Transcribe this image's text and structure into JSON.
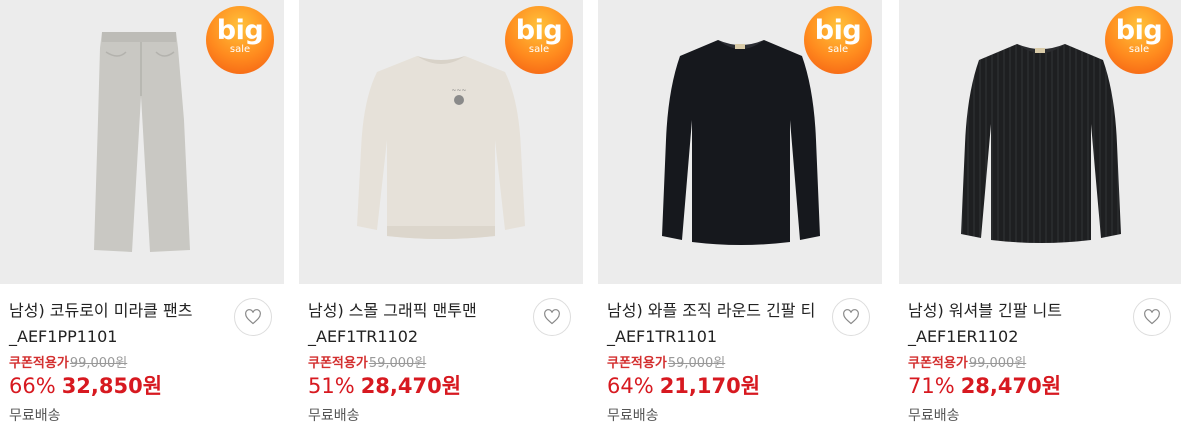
{
  "badge": {
    "big": "big",
    "sale": "sale"
  },
  "products": [
    {
      "title": "남성) 코듀로이 미라클 팬츠 _AEF1PP1101",
      "coupon_label": "쿠폰적용가",
      "original_price": "99,000원",
      "discount": "66%",
      "price": "32,850원",
      "shipping": "무료배송",
      "image": "pants",
      "color": "#c9c8c3"
    },
    {
      "title": "남성) 스몰 그래픽 맨투맨 _AEF1TR1102",
      "coupon_label": "쿠폰적용가",
      "original_price": "59,000원",
      "discount": "51%",
      "price": "28,470원",
      "shipping": "무료배송",
      "image": "sweatshirt",
      "color": "#e6e1d9"
    },
    {
      "title": "남성) 와플 조직 라운드 긴팔 티_AEF1TR1101",
      "coupon_label": "쿠폰적용가",
      "original_price": "59,000원",
      "discount": "64%",
      "price": "21,170원",
      "shipping": "무료배송",
      "image": "tshirt",
      "color": "#16181d"
    },
    {
      "title": "남성) 워셔블 긴팔 니트 _AEF1ER1102",
      "coupon_label": "쿠폰적용가",
      "original_price": "99,000원",
      "discount": "71%",
      "price": "28,470원",
      "shipping": "무료배송",
      "image": "knit",
      "color": "#1e1f21"
    }
  ]
}
